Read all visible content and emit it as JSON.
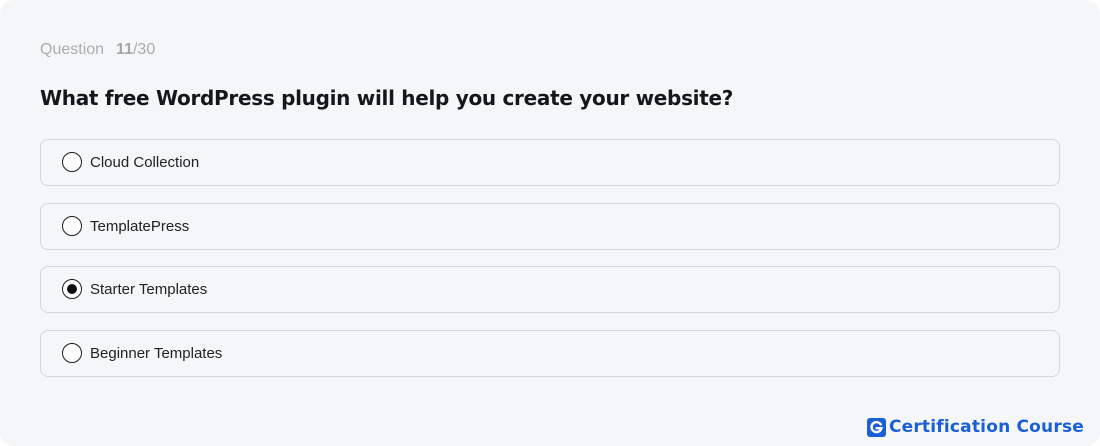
{
  "question": {
    "label": "Question",
    "current": "11",
    "total": "/30",
    "text": "What free WordPress plugin will help you create your website?"
  },
  "options": [
    {
      "label": "Cloud Collection",
      "selected": false
    },
    {
      "label": "TemplatePress",
      "selected": false
    },
    {
      "label": "Starter Templates",
      "selected": true
    },
    {
      "label": "Beginner Templates",
      "selected": false
    }
  ],
  "brand": {
    "text": "Certification Course",
    "icon": "g-logo-icon",
    "color": "#1a5fd6"
  }
}
